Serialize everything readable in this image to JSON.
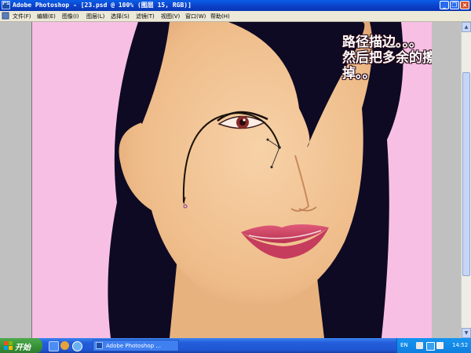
{
  "window": {
    "title": "Adobe Photoshop - [23.psd @ 100% (图层 15, RGB)]",
    "controls": [
      "minimize",
      "restore",
      "close"
    ]
  },
  "menu": {
    "items": [
      "文件(F)",
      "编辑(E)",
      "图像(I)",
      "图层(L)",
      "选择(S)",
      "滤镜(T)",
      "视图(V)",
      "窗口(W)",
      "帮助(H)"
    ]
  },
  "canvas": {
    "background_color": "#f8bfe4",
    "annotation_lines": [
      "路径描边。。。",
      "然后把多余的擦",
      "掉。。"
    ]
  },
  "taskbar": {
    "start_label": "开始",
    "task_button_label": "Adobe Photoshop ...",
    "language": "EN",
    "clock": "14:52"
  },
  "colors": {
    "titlebar": "#0b3fc7",
    "taskbar": "#245edb",
    "start_button": "#3c9a3c",
    "hair": "#0e0a24",
    "skin": "#f2c496",
    "lips": "#d84a6c"
  },
  "icons": [
    "photoshop-app-icon",
    "minimize-icon",
    "restore-icon",
    "close-icon",
    "windows-logo-icon",
    "ie-icon",
    "media-player-icon",
    "tray-help-icon",
    "tray-network-icon",
    "tray-volume-icon"
  ]
}
